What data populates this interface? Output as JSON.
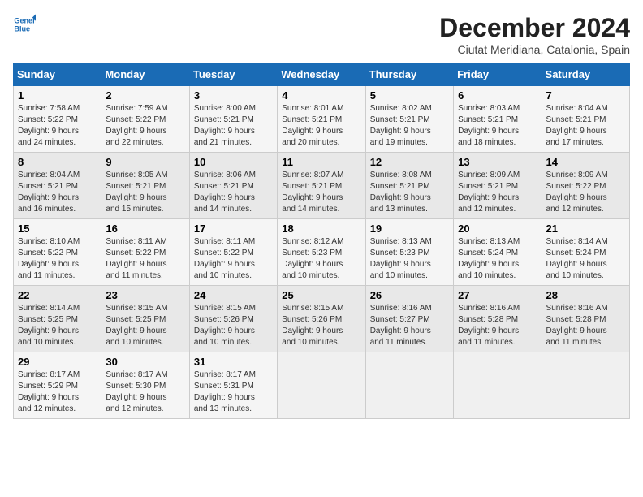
{
  "logo": {
    "line1": "General",
    "line2": "Blue"
  },
  "title": "December 2024",
  "subtitle": "Ciutat Meridiana, Catalonia, Spain",
  "headers": [
    "Sunday",
    "Monday",
    "Tuesday",
    "Wednesday",
    "Thursday",
    "Friday",
    "Saturday"
  ],
  "weeks": [
    [
      {
        "day": "1",
        "info": "Sunrise: 7:58 AM\nSunset: 5:22 PM\nDaylight: 9 hours\nand 24 minutes."
      },
      {
        "day": "2",
        "info": "Sunrise: 7:59 AM\nSunset: 5:22 PM\nDaylight: 9 hours\nand 22 minutes."
      },
      {
        "day": "3",
        "info": "Sunrise: 8:00 AM\nSunset: 5:21 PM\nDaylight: 9 hours\nand 21 minutes."
      },
      {
        "day": "4",
        "info": "Sunrise: 8:01 AM\nSunset: 5:21 PM\nDaylight: 9 hours\nand 20 minutes."
      },
      {
        "day": "5",
        "info": "Sunrise: 8:02 AM\nSunset: 5:21 PM\nDaylight: 9 hours\nand 19 minutes."
      },
      {
        "day": "6",
        "info": "Sunrise: 8:03 AM\nSunset: 5:21 PM\nDaylight: 9 hours\nand 18 minutes."
      },
      {
        "day": "7",
        "info": "Sunrise: 8:04 AM\nSunset: 5:21 PM\nDaylight: 9 hours\nand 17 minutes."
      }
    ],
    [
      {
        "day": "8",
        "info": "Sunrise: 8:04 AM\nSunset: 5:21 PM\nDaylight: 9 hours\nand 16 minutes."
      },
      {
        "day": "9",
        "info": "Sunrise: 8:05 AM\nSunset: 5:21 PM\nDaylight: 9 hours\nand 15 minutes."
      },
      {
        "day": "10",
        "info": "Sunrise: 8:06 AM\nSunset: 5:21 PM\nDaylight: 9 hours\nand 14 minutes."
      },
      {
        "day": "11",
        "info": "Sunrise: 8:07 AM\nSunset: 5:21 PM\nDaylight: 9 hours\nand 14 minutes."
      },
      {
        "day": "12",
        "info": "Sunrise: 8:08 AM\nSunset: 5:21 PM\nDaylight: 9 hours\nand 13 minutes."
      },
      {
        "day": "13",
        "info": "Sunrise: 8:09 AM\nSunset: 5:21 PM\nDaylight: 9 hours\nand 12 minutes."
      },
      {
        "day": "14",
        "info": "Sunrise: 8:09 AM\nSunset: 5:22 PM\nDaylight: 9 hours\nand 12 minutes."
      }
    ],
    [
      {
        "day": "15",
        "info": "Sunrise: 8:10 AM\nSunset: 5:22 PM\nDaylight: 9 hours\nand 11 minutes."
      },
      {
        "day": "16",
        "info": "Sunrise: 8:11 AM\nSunset: 5:22 PM\nDaylight: 9 hours\nand 11 minutes."
      },
      {
        "day": "17",
        "info": "Sunrise: 8:11 AM\nSunset: 5:22 PM\nDaylight: 9 hours\nand 10 minutes."
      },
      {
        "day": "18",
        "info": "Sunrise: 8:12 AM\nSunset: 5:23 PM\nDaylight: 9 hours\nand 10 minutes."
      },
      {
        "day": "19",
        "info": "Sunrise: 8:13 AM\nSunset: 5:23 PM\nDaylight: 9 hours\nand 10 minutes."
      },
      {
        "day": "20",
        "info": "Sunrise: 8:13 AM\nSunset: 5:24 PM\nDaylight: 9 hours\nand 10 minutes."
      },
      {
        "day": "21",
        "info": "Sunrise: 8:14 AM\nSunset: 5:24 PM\nDaylight: 9 hours\nand 10 minutes."
      }
    ],
    [
      {
        "day": "22",
        "info": "Sunrise: 8:14 AM\nSunset: 5:25 PM\nDaylight: 9 hours\nand 10 minutes."
      },
      {
        "day": "23",
        "info": "Sunrise: 8:15 AM\nSunset: 5:25 PM\nDaylight: 9 hours\nand 10 minutes."
      },
      {
        "day": "24",
        "info": "Sunrise: 8:15 AM\nSunset: 5:26 PM\nDaylight: 9 hours\nand 10 minutes."
      },
      {
        "day": "25",
        "info": "Sunrise: 8:15 AM\nSunset: 5:26 PM\nDaylight: 9 hours\nand 10 minutes."
      },
      {
        "day": "26",
        "info": "Sunrise: 8:16 AM\nSunset: 5:27 PM\nDaylight: 9 hours\nand 11 minutes."
      },
      {
        "day": "27",
        "info": "Sunrise: 8:16 AM\nSunset: 5:28 PM\nDaylight: 9 hours\nand 11 minutes."
      },
      {
        "day": "28",
        "info": "Sunrise: 8:16 AM\nSunset: 5:28 PM\nDaylight: 9 hours\nand 11 minutes."
      }
    ],
    [
      {
        "day": "29",
        "info": "Sunrise: 8:17 AM\nSunset: 5:29 PM\nDaylight: 9 hours\nand 12 minutes."
      },
      {
        "day": "30",
        "info": "Sunrise: 8:17 AM\nSunset: 5:30 PM\nDaylight: 9 hours\nand 12 minutes."
      },
      {
        "day": "31",
        "info": "Sunrise: 8:17 AM\nSunset: 5:31 PM\nDaylight: 9 hours\nand 13 minutes."
      },
      {
        "day": "",
        "info": ""
      },
      {
        "day": "",
        "info": ""
      },
      {
        "day": "",
        "info": ""
      },
      {
        "day": "",
        "info": ""
      }
    ]
  ]
}
